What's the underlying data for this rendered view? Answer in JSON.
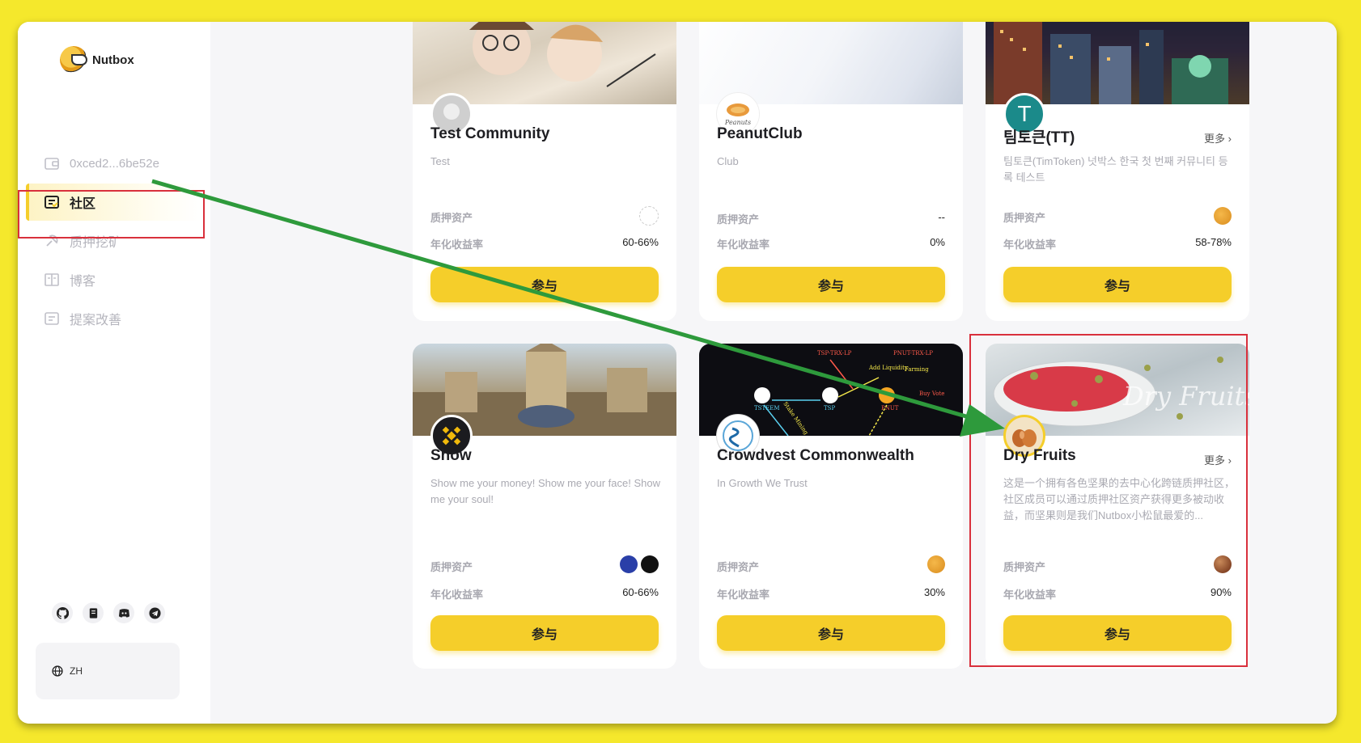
{
  "app": {
    "logo_text": "Nutbox"
  },
  "sidebar": {
    "wallet": "0xced2...6be52e",
    "items": [
      {
        "label": "社区",
        "icon": "community-icon",
        "active": true
      },
      {
        "label": "质押挖矿",
        "icon": "staking-icon"
      },
      {
        "label": "博客",
        "icon": "blog-icon"
      },
      {
        "label": "提案改善",
        "icon": "proposal-icon"
      }
    ],
    "social_icons": [
      "github-icon",
      "docs-icon",
      "discord-icon",
      "telegram-icon"
    ],
    "language": "ZH"
  },
  "labels": {
    "staked_assets": "质押资产",
    "apy": "年化收益率",
    "join": "参与",
    "more": "更多"
  },
  "communities": [
    {
      "name": "Test Community",
      "desc": "Test",
      "apy": "60-66%",
      "staked": ""
    },
    {
      "name": "PeanutClub",
      "desc": "Club",
      "apy": "0%",
      "staked": "--"
    },
    {
      "name": "팀토큰(TT)",
      "desc": "팀토큰(TimToken) 넛박스 한국 첫 번째 커뮤니티 등록 테스트",
      "apy": "58-78%",
      "staked": "",
      "more": true
    },
    {
      "name": "Show",
      "desc": "Show me your money! Show me your face! Show me your soul!",
      "apy": "60-66%",
      "staked": ""
    },
    {
      "name": "Crowdvest Commonwealth",
      "desc": "In Growth We Trust",
      "apy": "30%",
      "staked": ""
    },
    {
      "name": "Dry Fruits",
      "desc": "这是一个拥有各色坚果的去中心化跨链质押社区，社区成员可以通过质押社区资产获得更多被动收益，而坚果则是我们Nutbox小松鼠最爱的...",
      "apy": "90%",
      "staked": "",
      "more": true
    }
  ],
  "cover_texts": {
    "crowdvest": [
      "TSP-TRX-LP",
      "PNUT-TRX-LP",
      "Farming",
      "Add Liquidity",
      "Stake Mining",
      "TSTEEM",
      "TSP",
      "PNUT",
      "Buy Vote"
    ],
    "dryfruits": "Dry Fruits"
  },
  "avatar_letter": "T",
  "colors": {
    "accent": "#f5ce2a",
    "highlight": "#d9303c",
    "arrow": "#2e9a3c",
    "frame": "#f5e82c"
  }
}
